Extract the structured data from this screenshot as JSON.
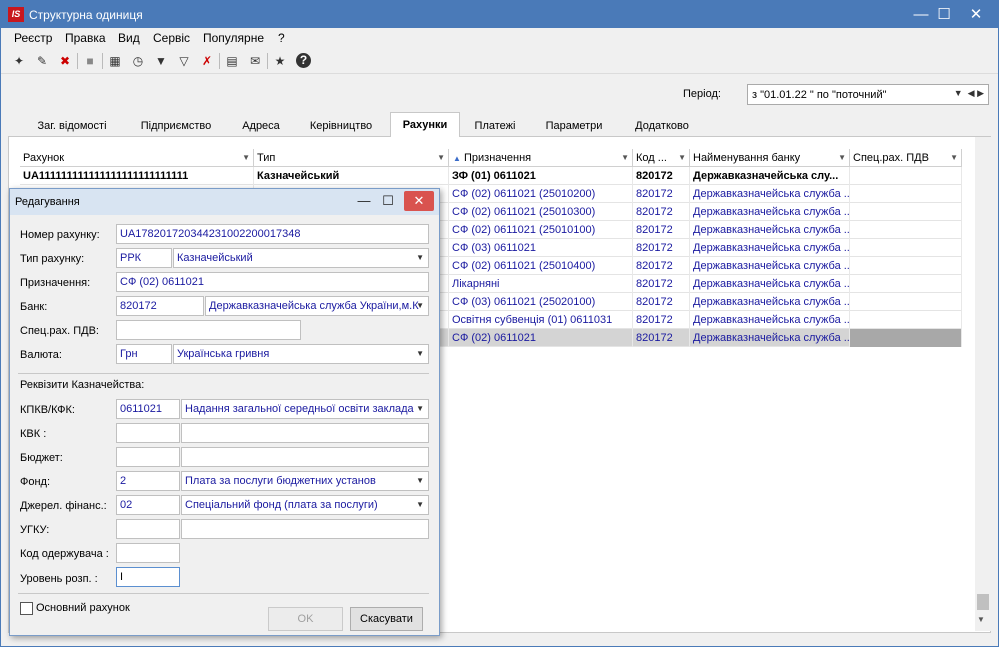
{
  "window": {
    "title": "Структурна одиниця",
    "logo": "IS"
  },
  "menu": [
    "Реєстр",
    "Правка",
    "Вид",
    "Сервіс",
    "Популярне",
    "?"
  ],
  "toolbar_icons": [
    "add-icon",
    "edit-icon",
    "delete-icon",
    "block-icon",
    "table-icon",
    "clock-icon",
    "filter-icon",
    "filter-add-icon",
    "filter-clear-icon",
    "document-icon",
    "mail-icon",
    "star-icon",
    "help-icon"
  ],
  "period": {
    "label": "Період:",
    "value": "з  \"01.01.22  \" по \"поточний\""
  },
  "tabs": [
    "Заг. відомості",
    "Підприємство",
    "Адреса",
    "Керівництво",
    "Рахунки",
    "Платежі",
    "Параметри",
    "Додатково"
  ],
  "active_tab": "Рахунки",
  "grid": {
    "columns": [
      "Рахунок",
      "Тип",
      "Призначення",
      "Код ...",
      "Найменування банку",
      "Спец.рах. ПДВ"
    ],
    "rows": [
      {
        "account": "UA111111111111111111111111111",
        "type": "Казначейський",
        "purpose": "ЗФ (01) 0611021",
        "code": "820172",
        "bank": "Державказначейська слу..."
      },
      {
        "account": "",
        "type": "",
        "purpose": "СФ (02) 0611021 (25010200)",
        "code": "820172",
        "bank": "Державказначейська служба ..."
      },
      {
        "account": "",
        "type": "",
        "purpose": "СФ (02) 0611021 (25010300)",
        "code": "820172",
        "bank": "Державказначейська служба ..."
      },
      {
        "account": "",
        "type": "",
        "purpose": "СФ (02) 0611021 (25010100)",
        "code": "820172",
        "bank": "Державказначейська служба ..."
      },
      {
        "account": "",
        "type": "",
        "purpose": "СФ (03) 0611021",
        "code": "820172",
        "bank": "Державказначейська служба ..."
      },
      {
        "account": "",
        "type": "",
        "purpose": "СФ (02) 0611021 (25010400)",
        "code": "820172",
        "bank": "Державказначейська служба ..."
      },
      {
        "account": "",
        "type": "",
        "purpose": "Лікарняні",
        "code": "820172",
        "bank": "Державказначейська служба ..."
      },
      {
        "account": "",
        "type": "",
        "purpose": "СФ (03) 0611021 (25020100)",
        "code": "820172",
        "bank": "Державказначейська служба ..."
      },
      {
        "account": "",
        "type": "",
        "purpose": "Освітня субвенція (01) 0611031",
        "code": "820172",
        "bank": "Державказначейська служба ..."
      },
      {
        "account": "",
        "type": "",
        "purpose": "СФ (02) 0611021",
        "code": "820172",
        "bank": "Державказначейська служба ..."
      }
    ]
  },
  "dialog": {
    "title": "Редагування",
    "account_label": "Номер рахунку:",
    "account_value": "UA178201720344231002200017348",
    "type_label": "Тип рахунку:",
    "type_code": "РРК",
    "type_value": "Казначейський",
    "purpose_label": "Призначення:",
    "purpose_value": "СФ (02) 0611021",
    "bank_label": "Банк:",
    "bank_code": "820172",
    "bank_value": "Державказначейська служба України,м.К",
    "vat_label": "Спец.рах. ПДВ:",
    "vat_value": "",
    "currency_label": "Валюта:",
    "currency_code": "Грн",
    "currency_value": "Українська гривня",
    "treasury_header": "Реквізити Казначейства:",
    "kpkv_label": "КПКВ/КФК:",
    "kpkv_code": "0611021",
    "kpkv_value": "Надання загальної середньої освіти заклада",
    "kvk_label": "КВК :",
    "budget_label": "Бюджет:",
    "fund_label": "Фонд:",
    "fund_code": "2",
    "fund_value": "Плата за послуги бюджетних установ",
    "source_label": "Джерел. фінанс.:",
    "source_code": "02",
    "source_value": "Спеціальний фонд (плата за послуги)",
    "ugku_label": "УГКУ:",
    "recipient_label": "Код одержувача :",
    "level_label": "Уровень розп. :",
    "level_value": "I",
    "main_account_label": "Основний рахунок",
    "ok_label": "OK",
    "cancel_label": "Скасувати"
  }
}
